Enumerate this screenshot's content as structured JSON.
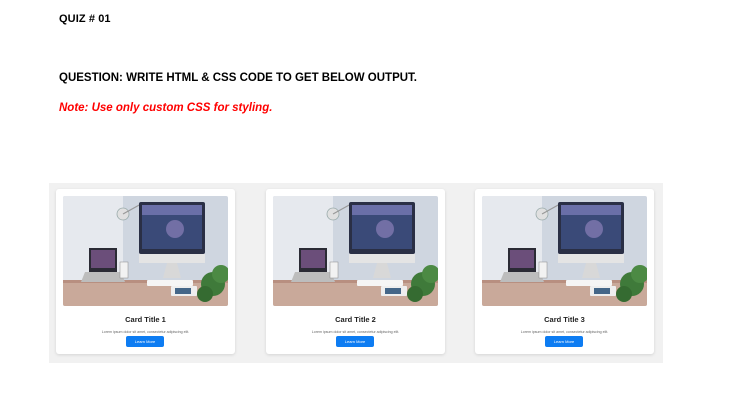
{
  "quiz": {
    "title": "QUIZ # 01",
    "question": "QUESTION: WRITE HTML & CSS CODE TO GET BELOW OUTPUT.",
    "note": "Note: Use only custom CSS for styling."
  },
  "colors": {
    "note": "#ff0000",
    "button": "#0d7cf2",
    "panel": "#f1f1f1"
  },
  "cards": [
    {
      "title": "Card Title 1",
      "text": "Lorem ipsum dolor sit amet, consectetur adipiscing elit.",
      "button_label": "Learn More",
      "image_icon": "desk-workspace-image"
    },
    {
      "title": "Card Title 2",
      "text": "Lorem ipsum dolor sit amet, consectetur adipiscing elit.",
      "button_label": "Learn More",
      "image_icon": "desk-workspace-image"
    },
    {
      "title": "Card Title 3",
      "text": "Lorem ipsum dolor sit amet, consectetur adipiscing elit.",
      "button_label": "Learn More",
      "image_icon": "desk-workspace-image"
    }
  ]
}
